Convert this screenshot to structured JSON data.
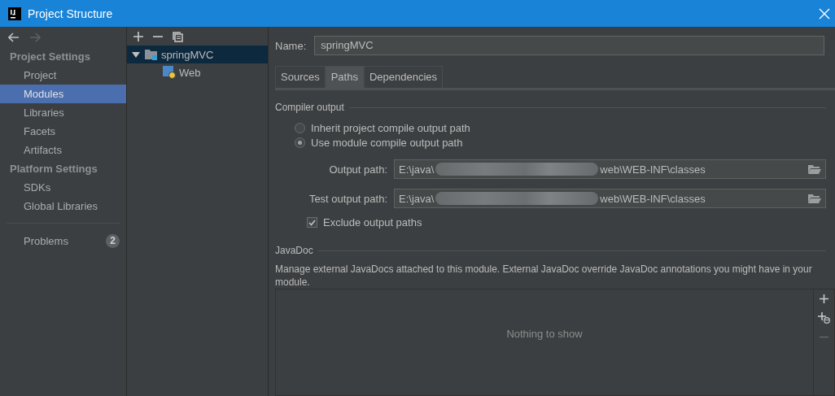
{
  "window": {
    "title": "Project Structure"
  },
  "sidebar": {
    "sections": [
      {
        "heading": "Project Settings",
        "items": [
          {
            "label": "Project",
            "selected": false
          },
          {
            "label": "Modules",
            "selected": true
          },
          {
            "label": "Libraries",
            "selected": false
          },
          {
            "label": "Facets",
            "selected": false
          },
          {
            "label": "Artifacts",
            "selected": false
          }
        ]
      },
      {
        "heading": "Platform Settings",
        "items": [
          {
            "label": "SDKs",
            "selected": false
          },
          {
            "label": "Global Libraries",
            "selected": false
          }
        ]
      }
    ],
    "problems": {
      "label": "Problems",
      "count": "2"
    }
  },
  "tree": {
    "items": [
      {
        "label": "springMVC",
        "kind": "module",
        "expanded": true,
        "selected": true,
        "children": [
          {
            "label": "Web",
            "kind": "facet",
            "selected": false
          }
        ]
      }
    ]
  },
  "name_field": {
    "label": "Name:",
    "value": "springMVC"
  },
  "tabs": [
    {
      "label": "Sources",
      "selected": false
    },
    {
      "label": "Paths",
      "selected": true
    },
    {
      "label": "Dependencies",
      "selected": false
    }
  ],
  "compiler_output": {
    "heading": "Compiler output",
    "options": [
      {
        "label": "Inherit project compile output path",
        "selected": false
      },
      {
        "label": "Use module compile output path",
        "selected": true
      }
    ],
    "paths": [
      {
        "label": "Output path:",
        "value_start": "E:\\java\\",
        "value_end": "web\\WEB-INF\\classes"
      },
      {
        "label": "Test output path:",
        "value_start": "E:\\java\\",
        "value_end": "web\\WEB-INF\\classes"
      }
    ],
    "exclude": {
      "label": "Exclude output paths",
      "checked": true
    }
  },
  "javadoc": {
    "heading": "JavaDoc",
    "description": "Manage external JavaDocs attached to this module. External JavaDoc override JavaDoc annotations you might have in your module.",
    "empty_text": "Nothing to show"
  }
}
